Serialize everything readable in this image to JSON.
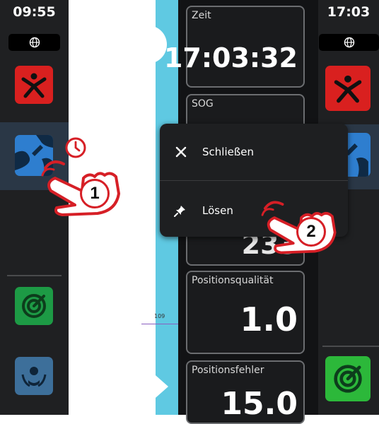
{
  "left_panel": {
    "time": "09:55",
    "apps": [
      "mob-app",
      "chart-app",
      "radar-app",
      "autopilot-app"
    ]
  },
  "right_panel": {
    "time": "17:03",
    "apps": [
      "mob-app",
      "chart-app",
      "radar-app"
    ]
  },
  "data_boxes": [
    {
      "label": "Zeit",
      "value": "17:03:32"
    },
    {
      "label": "SOG",
      "value": ""
    },
    {
      "label": "",
      "value": "233"
    },
    {
      "label": "Positionsqualität",
      "value": "1.0"
    },
    {
      "label": "Positionsfehler",
      "value": "15.0"
    }
  ],
  "chart": {
    "scale_label": "109"
  },
  "popup_menu": {
    "items": [
      {
        "icon": "close-icon",
        "label": "Schließen"
      },
      {
        "icon": "pin-icon",
        "label": "Lösen"
      }
    ]
  },
  "callouts": {
    "step1": "1",
    "step2": "2"
  },
  "colors": {
    "sidebar_bg": "#1f2022",
    "mob_red": "#d9201f",
    "chart_blue": "#2e7ecf",
    "radar_green": "#1d9a45",
    "callout_red": "#d61f26",
    "water": "#5fc9e2"
  }
}
